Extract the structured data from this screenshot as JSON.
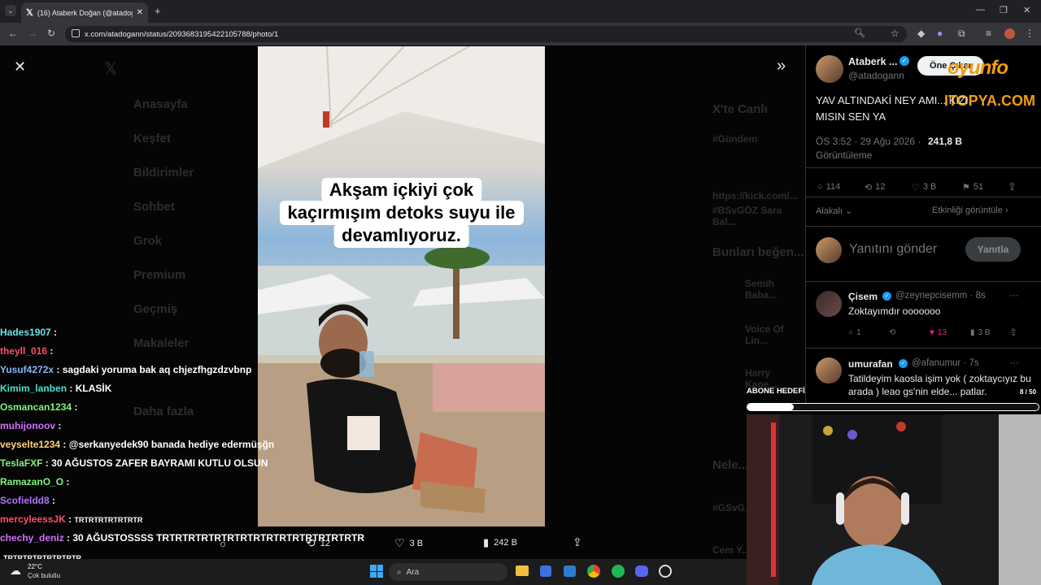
{
  "browser": {
    "tab_title": "(16) Ataberk Doğan (@atadoga...",
    "url": "x.com/atadogann/status/2093683195422105788/photo/1"
  },
  "background_nav": [
    "Anasayfa",
    "Keşfet",
    "Bildirimler",
    "Sohbet",
    "Grok",
    "Premium",
    "Geçmiş",
    "Makaleler",
    "",
    "Daha fazla"
  ],
  "background_right": {
    "live_title": "X'te Canlı",
    "live_sub": "#Gündem",
    "live_link": "https://kick.com/...",
    "live_tag": "#BSvGÖZ Sara Bal...",
    "suggest_title": "Bunları beğen...",
    "suggest_1": "Semih Baba...",
    "suggest_2": "Voice Of Lin...",
    "suggest_3": "Harry Kane...",
    "whats_happening": "Nele...",
    "tag2": "#GSvG...",
    "person": "Cem Y..."
  },
  "photo": {
    "caption_lines": [
      "Akşam içkiyi çok",
      "kaçırmışım detoks suyu ile",
      "devamlıyoruz."
    ]
  },
  "media_actions": {
    "retweets": "12",
    "likes": "3 B",
    "views": "242 B"
  },
  "tweet": {
    "author": "Ataberk ...",
    "handle": "@atadogann",
    "follow_label": "Öne Çıkar",
    "text": "YAV ALTINDAKİ NEY AMI... KIZI MISIN SEN YA",
    "time": "ÖS 3:52 · 29 Ağu 2026 ·",
    "views": "241,8 B",
    "views_label": "Görüntüleme",
    "stats": {
      "replies": "114",
      "retweets": "12",
      "likes": "3 B",
      "bookmarks": "51"
    },
    "sort_label": "Alakalı",
    "activity_label": "Etkinliği görüntüle",
    "reply_placeholder": "Yanıtını gönder",
    "reply_button": "Yanıtla"
  },
  "watermark": {
    "line1": "oyunfo",
    "line2": "ITOPYA.COM"
  },
  "replies": [
    {
      "name": "Çisem",
      "handle": "@zeynepcisemm · 8s",
      "text": "Zoktayımdır ooooooo",
      "replies": "1",
      "likes": "13",
      "views": "3 B"
    },
    {
      "name": "umurafan",
      "handle": "@afanumur · 7s",
      "text": "Tatildeyim kaosla işim yok ( zoktaycıyız bu arada ) leao gs'nin elde... patlar."
    }
  ],
  "sub_goal": {
    "label": "ABONE HEDEFİ",
    "count": "8 / 50",
    "fraction": 0.16
  },
  "chat": [
    {
      "user": "Hades1907",
      "color": "#6ee0e0",
      "msg": ""
    },
    {
      "user": "theyll_016",
      "color": "#ff4d6d",
      "msg": ""
    },
    {
      "user": "Yusuf4272x",
      "color": "#8ab4f8",
      "msg": "sagdaki yoruma bak aq chjezfhgzdzvbnp"
    },
    {
      "user": "Kimim_lanben",
      "color": "#4fe0d0",
      "msg": "KLASİK"
    },
    {
      "user": "Osmancan1234",
      "color": "#7cf57c",
      "msg": ""
    },
    {
      "user": "muhijonoov",
      "color": "#d070ff",
      "msg": ""
    },
    {
      "user": "veyselte1234",
      "color": "#ffd27a",
      "msg": "@serkanyedek90 banada hediye edermüşğn"
    },
    {
      "user": "TeslaFXF",
      "color": "#7cf57c",
      "msg": "30 AĞUSTOS ZAFER BAYRAMI KUTLU OLSUN"
    },
    {
      "user": "RamazanO_O",
      "color": "#7cf57c",
      "msg": ""
    },
    {
      "user": "Scofieldd8",
      "color": "#b070ff",
      "msg": ""
    },
    {
      "user": "mercyleessJK",
      "color": "#ff4d6d",
      "msg": "TRTRTRTRTRTRTR"
    },
    {
      "user": "chechy_deniz",
      "color": "#d070ff",
      "msg": "30 AĞUSTOSSSS TRTRTRTRTRTRTRTRTRTRTRTRTRTRTRTR"
    }
  ],
  "chat_overflow": "TRTRTRTRTRTRTRTR",
  "taskbar": {
    "temp": "22°C",
    "weather": "Çok bulutlu",
    "search": "Ara"
  }
}
